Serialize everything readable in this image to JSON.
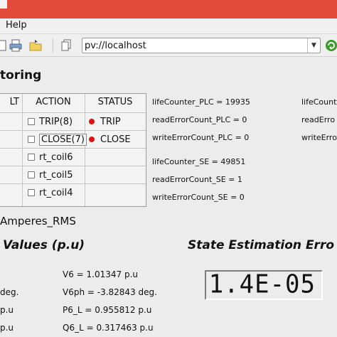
{
  "menu": {
    "help": "Help"
  },
  "toolbar": {
    "url_value": "pv://localhost",
    "url_dropdown_glyph": "▼"
  },
  "section": {
    "title": "toring"
  },
  "grid": {
    "headers": [
      "LT",
      "ACTION",
      "STATUS"
    ],
    "rows": [
      {
        "action": "TRIP(8)",
        "action_boxed": false,
        "status": "TRIP",
        "status_dot": true
      },
      {
        "action": "CLOSE(7)",
        "action_boxed": true,
        "status": "CLOSE",
        "status_dot": true
      },
      {
        "action": "rt_coil6",
        "action_boxed": false,
        "status": "",
        "status_dot": false
      },
      {
        "action": "rt_coil5",
        "action_boxed": false,
        "status": "",
        "status_dot": false
      },
      {
        "action": "rt_coil4",
        "action_boxed": false,
        "status": "",
        "status_dot": false
      }
    ]
  },
  "counters": {
    "life_plc": "lifeCounter_PLC = 19935",
    "read_err_plc": "readErrorCount_PLC = 0",
    "write_err_plc": "writeErrorCount_PLC = 0",
    "life_se": "lifeCounter_SE = 49851",
    "read_err_se": "readErrorCount_SE = 1",
    "write_err_se": "writeErrorCount_SE = 0",
    "right_col": [
      "lifeCounter",
      "readErro",
      "writeErro"
    ]
  },
  "amperes_label": "Amperes_RMS",
  "values_heading": "Values (p.u)",
  "state_heading": "State Estimation Erro",
  "values": {
    "v6": "V6 = 1.01347 p.u",
    "v6ph": "V6ph = -3.82843 deg.",
    "p6l": "P6_L = 0.955812 p.u",
    "q6l": "Q6_L = 0.317463 p.u",
    "left_deg": "deg.",
    "left_pu_1": "p.u",
    "left_pu_2": "p.u"
  },
  "lcd": {
    "value": "1.4E-05"
  },
  "colors": {
    "titlebar": "#e24a3b",
    "status_dot": "#d81313"
  }
}
